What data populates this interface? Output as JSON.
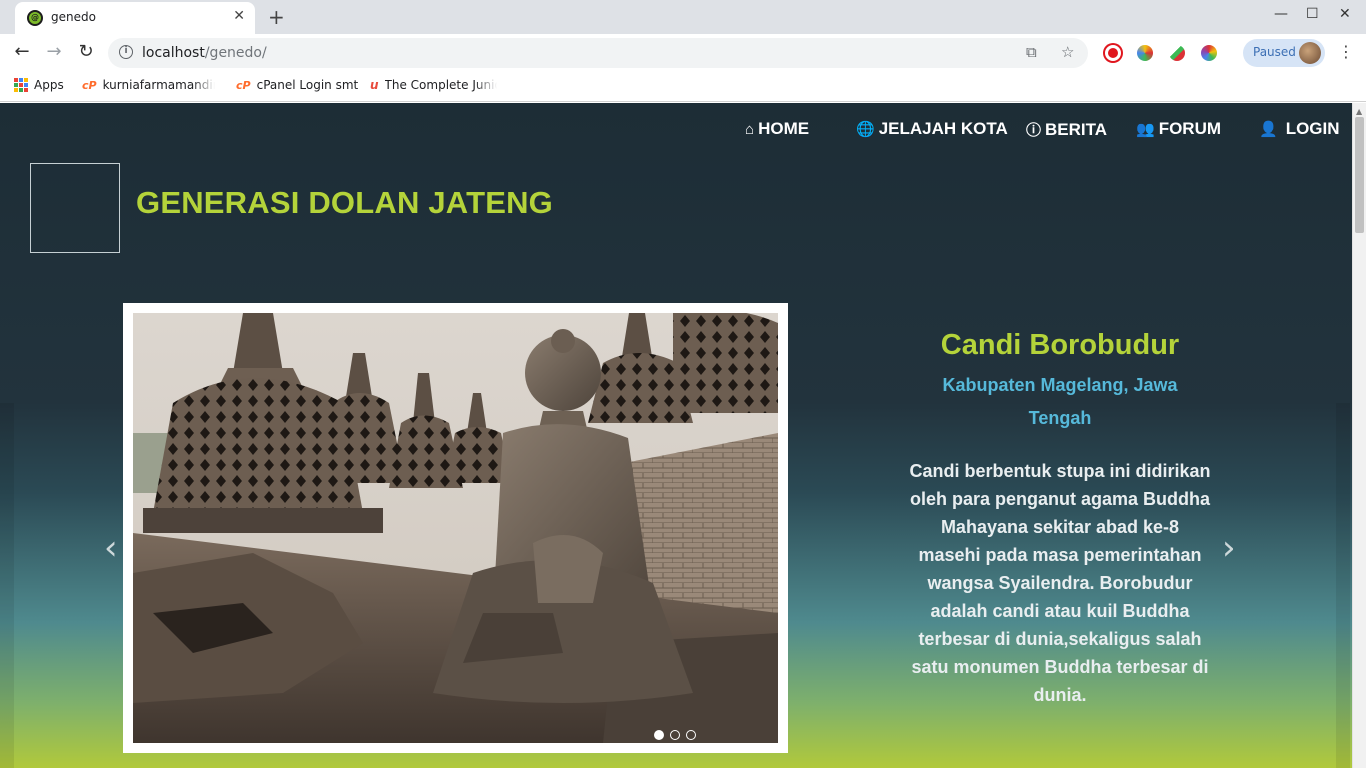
{
  "browser": {
    "tab_title": "genedo",
    "url_host": "localhost",
    "url_path": "/genedo/",
    "paused_label": "Paused",
    "bookmarks": [
      {
        "label": "Apps",
        "icon": "apps-grid-icon"
      },
      {
        "label": "kurniafarmamandiri",
        "icon": "cpanel-icon"
      },
      {
        "label": "cPanel Login smt",
        "icon": "cpanel-icon"
      },
      {
        "label": "The Complete Junior",
        "icon": "udemy-icon"
      }
    ]
  },
  "site": {
    "title": "GENERASI DOLAN JATENG",
    "nav": [
      {
        "label": "HOME",
        "icon": "home-icon"
      },
      {
        "label": "JELAJAH KOTA",
        "icon": "globe-icon"
      },
      {
        "label": "BERITA",
        "icon": "info-circle-icon"
      },
      {
        "label": "FORUM",
        "icon": "users-icon"
      },
      {
        "label": "LOGIN",
        "icon": "user-icon"
      }
    ]
  },
  "slide": {
    "title": "Candi Borobudur",
    "location": "Kabupaten Magelang, Jawa Tengah",
    "description": "Candi berbentuk stupa ini didirikan oleh para penganut agama Buddha Mahayana sekitar abad ke-8 masehi pada masa pemerintahan wangsa Syailendra. Borobudur adalah candi atau kuil Buddha terbesar di dunia,sekaligus salah satu monumen Buddha terbesar di dunia.",
    "image": "borobudur-buddha-statue-photo",
    "indicator_count": 3,
    "active_index": 0
  },
  "colors": {
    "title_green": "#b4d33a",
    "location_blue": "#56b9da",
    "header_dark": "#1d2d36"
  }
}
